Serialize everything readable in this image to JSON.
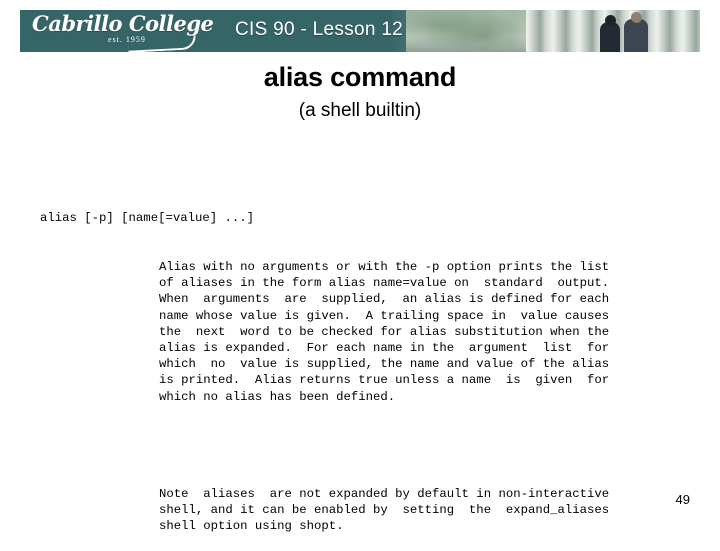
{
  "banner": {
    "course_title": "CIS 90 - Lesson 12",
    "logo_name": "Cabrillo College",
    "logo_est": "est. 1959",
    "teal_color": "#366568"
  },
  "slide": {
    "title": "alias command",
    "subtitle": "(a shell builtin)",
    "page_number": "49"
  },
  "manpage": {
    "synopsis": "alias [-p] [name[=value] ...]",
    "paragraph1": [
      "Alias with no arguments or with the -p option prints the list",
      "of aliases in the form alias name=value on  standard  output.",
      "When  arguments  are  supplied,  an alias is defined for each",
      "name whose value is given.  A trailing space in  value causes",
      "the  next  word to be checked for alias substitution when the",
      "alias is expanded.  For each name in the  argument  list  for",
      "which  no  value is supplied, the name and value of the alias",
      "is printed.  Alias returns true unless a name  is  given  for",
      "which no alias has been defined."
    ],
    "paragraph2": [
      "Note  aliases  are not expanded by default in non-interactive",
      "shell, and it can be enabled by  setting  the  expand_aliases",
      "shell option using shopt."
    ]
  }
}
